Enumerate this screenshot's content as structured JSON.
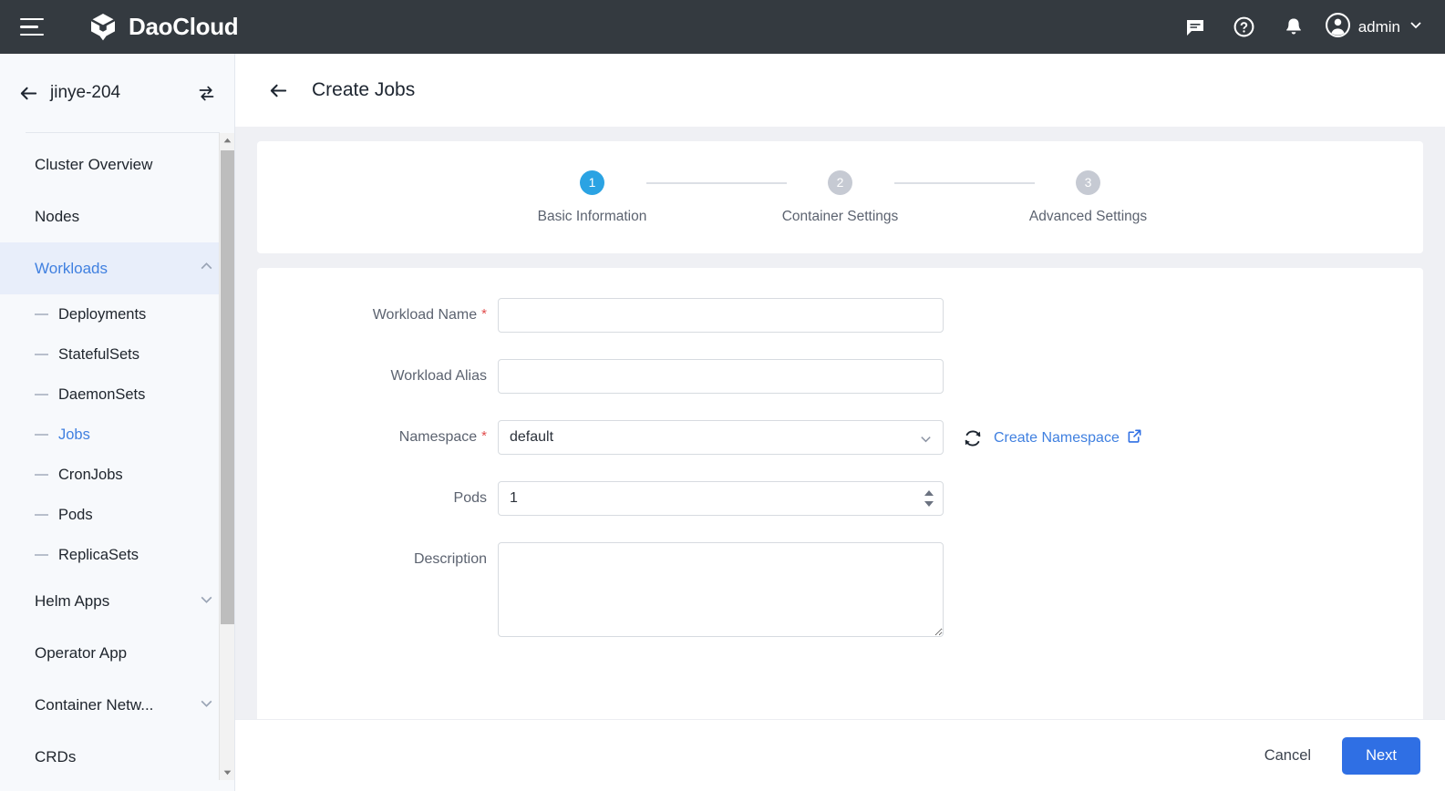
{
  "topbar": {
    "menu_icon": "hamburger-icon",
    "brand": "DaoCloud",
    "icons": [
      "chat-icon",
      "help-icon",
      "bell-icon"
    ],
    "user": "admin",
    "user_chevron": "chevron-down-icon"
  },
  "sidebar": {
    "back_icon": "arrow-left-icon",
    "cluster": "jinye-204",
    "switch_icon": "switch-cluster-icon",
    "items": [
      {
        "label": "Cluster Overview",
        "type": "item",
        "state": "normal"
      },
      {
        "label": "Nodes",
        "type": "item",
        "state": "normal"
      },
      {
        "label": "Workloads",
        "type": "group",
        "state": "expanded",
        "chevron": "chevron-up-icon"
      },
      {
        "label": "Deployments",
        "type": "sub",
        "state": "normal"
      },
      {
        "label": "StatefulSets",
        "type": "sub",
        "state": "normal"
      },
      {
        "label": "DaemonSets",
        "type": "sub",
        "state": "normal"
      },
      {
        "label": "Jobs",
        "type": "sub",
        "state": "active"
      },
      {
        "label": "CronJobs",
        "type": "sub",
        "state": "normal"
      },
      {
        "label": "Pods",
        "type": "sub",
        "state": "normal"
      },
      {
        "label": "ReplicaSets",
        "type": "sub",
        "state": "normal"
      },
      {
        "label": "Helm Apps",
        "type": "group",
        "state": "collapsed",
        "chevron": "chevron-down-icon"
      },
      {
        "label": "Operator App",
        "type": "item",
        "state": "normal"
      },
      {
        "label": "Container Netw...",
        "type": "group",
        "state": "collapsed",
        "chevron": "chevron-down-icon"
      },
      {
        "label": "CRDs",
        "type": "item",
        "state": "normal"
      }
    ]
  },
  "page": {
    "back_icon": "arrow-left-icon",
    "title": "Create Jobs"
  },
  "stepper": {
    "steps": [
      {
        "number": "1",
        "label": "Basic Information",
        "state": "active"
      },
      {
        "number": "2",
        "label": "Container Settings",
        "state": "inactive"
      },
      {
        "number": "3",
        "label": "Advanced Settings",
        "state": "inactive"
      }
    ]
  },
  "form": {
    "fields": [
      {
        "label": "Workload Name",
        "required": true,
        "type": "text",
        "value": "",
        "placeholder": ""
      },
      {
        "label": "Workload Alias",
        "required": false,
        "type": "text",
        "value": "",
        "placeholder": ""
      },
      {
        "label": "Namespace",
        "required": true,
        "type": "select",
        "value": "default",
        "options": [
          "default"
        ]
      },
      {
        "label": "Pods",
        "required": false,
        "type": "number",
        "value": "1"
      },
      {
        "label": "Description",
        "required": false,
        "type": "textarea",
        "value": "",
        "placeholder": ""
      }
    ],
    "namespace_refresh_icon": "refresh-icon",
    "namespace_link": "Create Namespace",
    "namespace_link_icon": "external-link-icon",
    "required_mark": "*"
  },
  "footer": {
    "cancel": "Cancel",
    "next": "Next"
  },
  "colors": {
    "topbar_bg": "#343a40",
    "sidebar_bg": "#f7f9fc",
    "content_bg": "#eff0f4",
    "accent_blue": "#4080e0",
    "primary_button": "#2f6fe4",
    "step_active": "#2ba3e3",
    "step_inactive": "#c6cad3",
    "required_red": "#e14d4d"
  }
}
